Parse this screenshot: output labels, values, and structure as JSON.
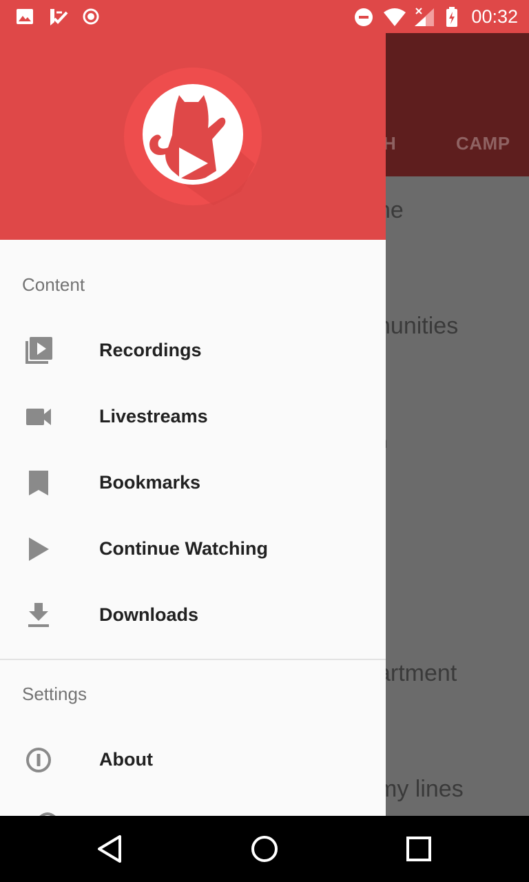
{
  "status_bar": {
    "time": "00:32",
    "icons": [
      "image-icon",
      "checklist-icon",
      "record-icon",
      "do-not-disturb-icon",
      "wifi-icon",
      "signal-icon",
      "battery-charging-icon"
    ]
  },
  "background": {
    "tabs": [
      "H",
      "CAMP"
    ],
    "lines": [
      "ne",
      "nunities",
      "n",
      "artment",
      "my lines"
    ]
  },
  "drawer": {
    "content_section": "Content",
    "items": [
      {
        "label": "Recordings",
        "icon": "video-library-icon"
      },
      {
        "label": "Livestreams",
        "icon": "videocam-icon"
      },
      {
        "label": "Bookmarks",
        "icon": "bookmark-icon"
      },
      {
        "label": "Continue Watching",
        "icon": "play-arrow-icon"
      },
      {
        "label": "Downloads",
        "icon": "download-icon"
      }
    ],
    "settings_section": "Settings",
    "settings_items": [
      {
        "label": "About",
        "icon": "info-icon"
      }
    ]
  },
  "colors": {
    "primary": "#df4848",
    "dark_scrim_appbar": "#5e1e1e",
    "drawer_bg": "#fafafa"
  },
  "navigation_bar": [
    "back-button",
    "home-button",
    "recents-button"
  ]
}
